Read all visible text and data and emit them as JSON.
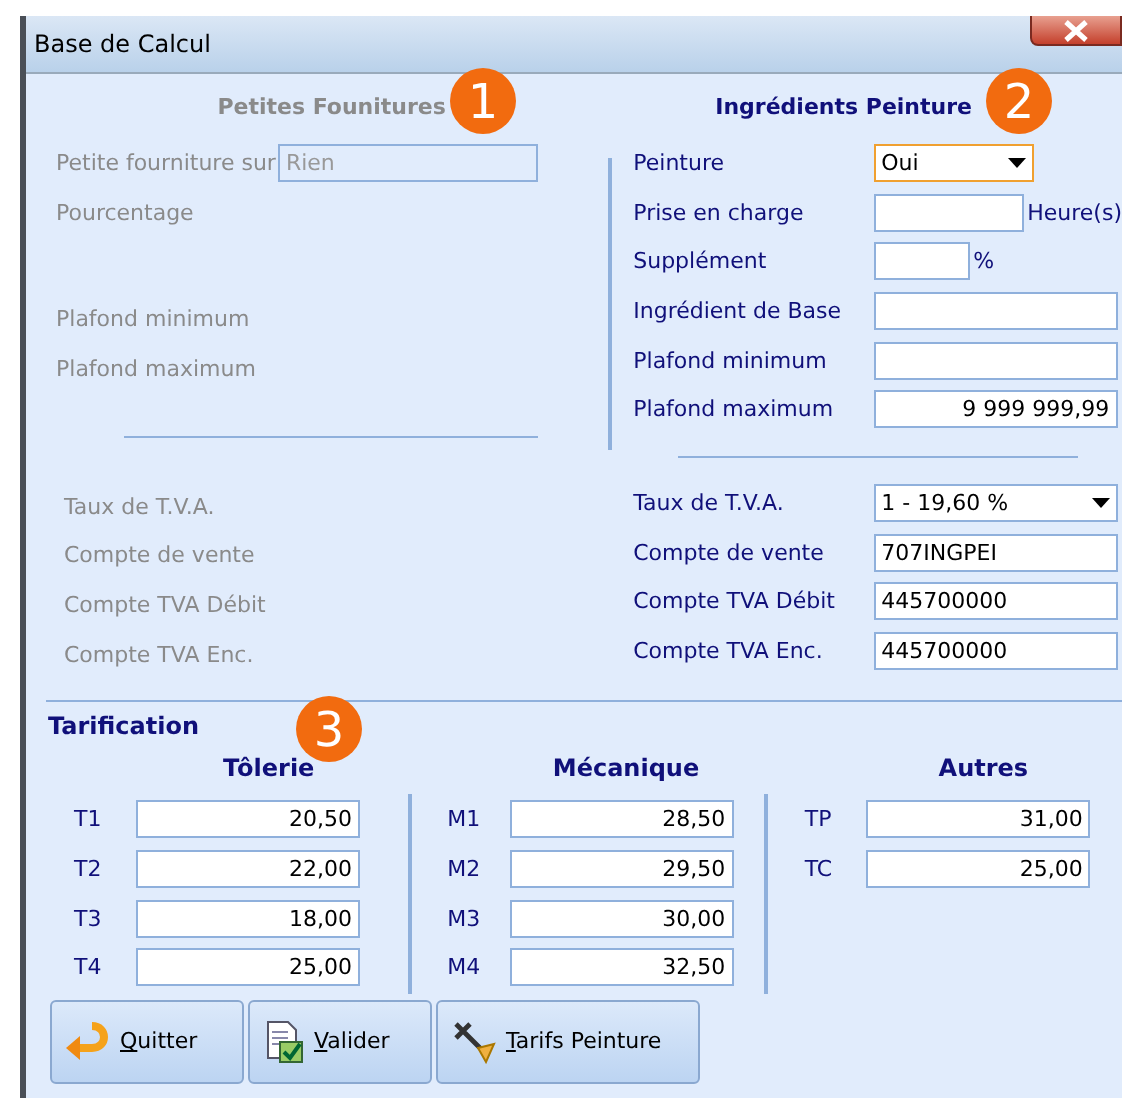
{
  "window": {
    "title": "Base de Calcul"
  },
  "markers": [
    {
      "label": "1"
    },
    {
      "label": "2"
    },
    {
      "label": "3"
    }
  ],
  "petites_fournitures": {
    "title": "Petites Founitures",
    "disabled": true,
    "rows": [
      {
        "label": "Petite fourniture sur",
        "kind": "input",
        "value": "Rien"
      },
      {
        "label": "Pourcentage"
      }
    ],
    "plafond_rows": [
      {
        "label": "Plafond minimum"
      },
      {
        "label": "Plafond maximum"
      }
    ],
    "tva_rows": [
      {
        "label": "Taux de T.V.A."
      },
      {
        "label": "Compte de vente"
      },
      {
        "label": "Compte TVA Débit"
      },
      {
        "label": "Compte TVA Enc."
      }
    ]
  },
  "ingredients_peinture": {
    "title": "Ingrédients Peinture",
    "disabled": false,
    "rows": [
      {
        "label": "Peinture",
        "kind": "select",
        "value": "Oui",
        "focused": true
      },
      {
        "label": "Prise en charge",
        "kind": "input",
        "suffix": "Heure(s)"
      },
      {
        "label": "Supplément",
        "kind": "input",
        "suffix": "%"
      },
      {
        "label": "Ingrédient de Base",
        "kind": "input"
      },
      {
        "label": "Plafond minimum",
        "kind": "input"
      },
      {
        "label": "Plafond maximum",
        "kind": "number_input",
        "value": "9 999 999,99"
      }
    ],
    "tva_rows": [
      {
        "label": "Taux de T.V.A.",
        "kind": "select",
        "value": "1 - 19,60 %",
        "focused": false
      },
      {
        "label": "Compte de vente",
        "kind": "input",
        "value": "707INGPEI"
      },
      {
        "label": "Compte TVA Débit",
        "kind": "input",
        "value": "445700000"
      },
      {
        "label": "Compte TVA Enc.",
        "kind": "input",
        "value": "445700000"
      }
    ]
  },
  "tarification": {
    "title": "Tarification",
    "groups": [
      {
        "title": "Tôlerie",
        "rows": [
          {
            "label": "T1",
            "value": "20,50"
          },
          {
            "label": "T2",
            "value": "22,00"
          },
          {
            "label": "T3",
            "value": "18,00"
          },
          {
            "label": "T4",
            "value": "25,00"
          }
        ]
      },
      {
        "title": "Mécanique",
        "rows": [
          {
            "label": "M1",
            "value": "28,50"
          },
          {
            "label": "M2",
            "value": "29,50"
          },
          {
            "label": "M3",
            "value": "30,00"
          },
          {
            "label": "M4",
            "value": "32,50"
          }
        ]
      },
      {
        "title": "Autres",
        "rows": [
          {
            "label": "TP",
            "value": "31,00"
          },
          {
            "label": "TC",
            "value": "25,00"
          }
        ]
      }
    ]
  },
  "buttons": [
    {
      "kind": "quit",
      "mnemonic": "Q",
      "label": "uitter"
    },
    {
      "kind": "validate",
      "mnemonic": "V",
      "label": "alider"
    },
    {
      "kind": "paint",
      "mnemonic": "T",
      "label": "arifs Peinture"
    }
  ]
}
